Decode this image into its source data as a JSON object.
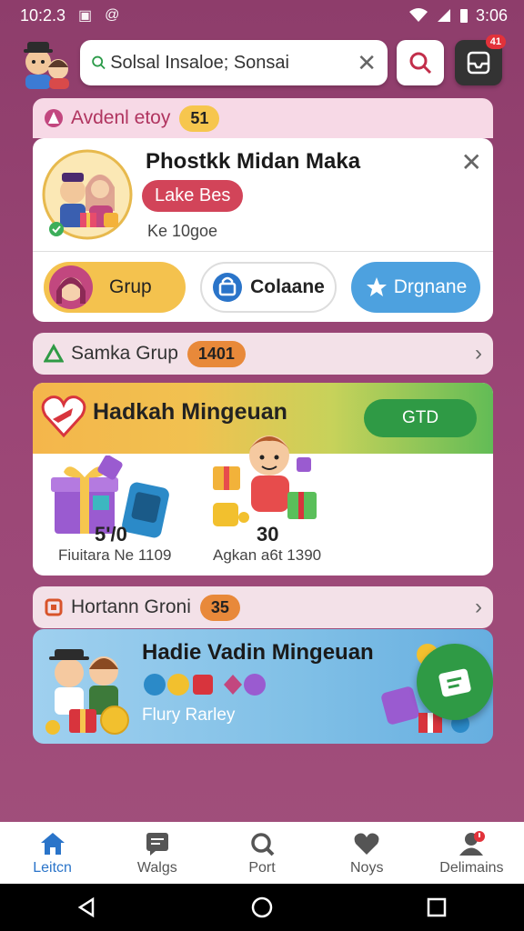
{
  "status_bar": {
    "time": "10:2.3",
    "right_time": "3:06",
    "glyph_a": "▣",
    "glyph_b": "@"
  },
  "search": {
    "value": "Solsal Insaloe; Sonsai"
  },
  "inbox_badge": "41",
  "section1": {
    "label": "Avdenl etoy",
    "count": "51"
  },
  "card1": {
    "title": "Phostkk Midan Maka",
    "pill": "Lake Bes",
    "subtitle": "Ke 10goe",
    "btn_grup": "Grup",
    "btn_colaane": "Colaane",
    "btn_drgnane": "Drgnane"
  },
  "section2": {
    "label": "Samka Grup",
    "count": "1401"
  },
  "card2": {
    "title": "Hadkah Mingeuan",
    "badge": "GTD",
    "item1_value": "5'/0",
    "item1_sub": "Fiuitara Ne 1109",
    "item2_value": "30",
    "item2_sub": "Agkan a6t 1390"
  },
  "section3": {
    "label": "Hortann Groni",
    "count": "35"
  },
  "card3": {
    "title": "Hadie Vadin Mingeuan",
    "subtitle": "Flury Rarley"
  },
  "nav": [
    {
      "label": "Leitcn",
      "icon": "home-icon"
    },
    {
      "label": "Walgs",
      "icon": "chat-icon"
    },
    {
      "label": "Port",
      "icon": "search-icon"
    },
    {
      "label": "Noys",
      "icon": "heart-icon"
    },
    {
      "label": "Delimains",
      "icon": "people-icon"
    }
  ],
  "colors": {
    "accent_blue": "#2a74c9",
    "pill_red": "#d24459",
    "gtd_green": "#2f9a45",
    "grup_yellow": "#f4c24e"
  }
}
